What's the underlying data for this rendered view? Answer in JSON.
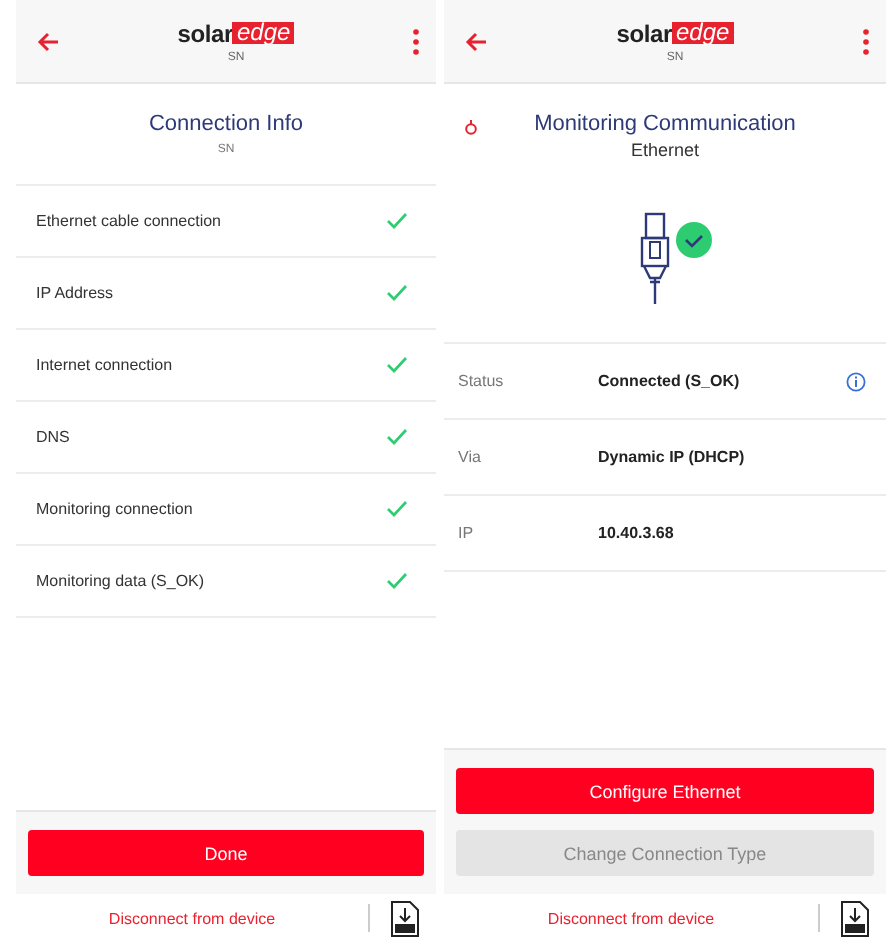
{
  "screens": [
    {
      "header": {
        "logo_left": "solar",
        "logo_right": "edge",
        "subtitle": "SN"
      },
      "title": "Connection Info",
      "title_icon": false,
      "subtitle": "SN",
      "illustration": false,
      "rows": [
        {
          "kind": "check",
          "label": "Ethernet cable connection",
          "ok": true
        },
        {
          "kind": "check",
          "label": "IP Address",
          "ok": true
        },
        {
          "kind": "check",
          "label": "Internet connection",
          "ok": true
        },
        {
          "kind": "check",
          "label": "DNS",
          "ok": true
        },
        {
          "kind": "check",
          "label": "Monitoring connection",
          "ok": true
        },
        {
          "kind": "check",
          "label": "Monitoring data (S_OK)",
          "ok": true
        }
      ],
      "buttons": [
        {
          "label": "Done",
          "disabled": false
        }
      ],
      "footer": {
        "link": "Disconnect from device"
      }
    },
    {
      "header": {
        "logo_left": "solar",
        "logo_right": "edge",
        "subtitle": "SN"
      },
      "title": "Monitoring Communication",
      "title_icon": true,
      "subtitle": "Ethernet",
      "illustration": true,
      "rows": [
        {
          "kind": "field",
          "label": "Status",
          "value": "Connected (S_OK)",
          "info": true
        },
        {
          "kind": "field",
          "label": "Via",
          "value": "Dynamic IP (DHCP)",
          "info": false
        },
        {
          "kind": "field",
          "label": "IP",
          "value": "10.40.3.68",
          "info": false
        }
      ],
      "buttons": [
        {
          "label": "Configure Ethernet",
          "disabled": false
        },
        {
          "label": "Change Connection Type",
          "disabled": true
        }
      ],
      "footer": {
        "link": "Disconnect from device"
      }
    }
  ]
}
